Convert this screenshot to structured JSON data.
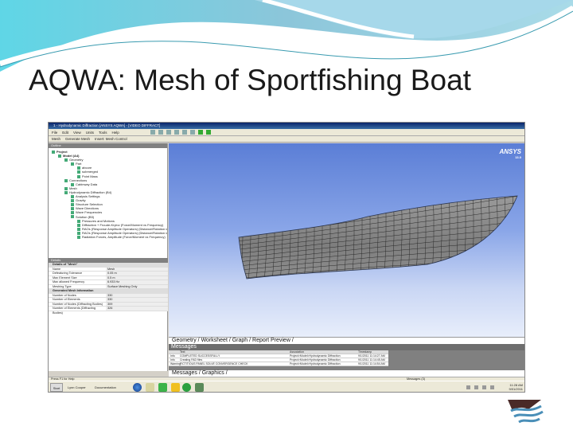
{
  "slide": {
    "title": "AQWA: Mesh of Sportfishing Boat"
  },
  "app": {
    "window_title": "1 - Hydrodynamic Diffraction [ANSYS AQWA] - [VIDEO DIFFRACT]",
    "menu": [
      "File",
      "Edit",
      "View",
      "Units",
      "Tools",
      "Help"
    ],
    "toolbar2": [
      "Mesh",
      "Generate Mesh",
      "Insert: Mesh Control"
    ],
    "outline_header": "Outline",
    "tree": [
      {
        "label": "Project",
        "level": 0
      },
      {
        "label": "Model (A4)",
        "level": 1
      },
      {
        "label": "Geometry",
        "level": 2
      },
      {
        "label": "Part",
        "level": 3
      },
      {
        "label": "abcore",
        "level": 4
      },
      {
        "label": "submerged",
        "level": 4
      },
      {
        "label": "Point Mass",
        "level": 4
      },
      {
        "label": "Connections",
        "level": 2
      },
      {
        "label": "Cabinway Data",
        "level": 3
      },
      {
        "label": "Mesh",
        "level": 2
      },
      {
        "label": "Hydrodynamic Diffraction (B4)",
        "level": 2
      },
      {
        "label": "Analysis Settings",
        "level": 3
      },
      {
        "label": "Gravity",
        "level": 3
      },
      {
        "label": "Structure Selection",
        "level": 3
      },
      {
        "label": "Wave Directions",
        "level": 3
      },
      {
        "label": "Wave Frequencies",
        "level": 3
      },
      {
        "label": "Solution (B5)",
        "level": 3
      },
      {
        "label": "Pressures and Motions",
        "level": 4
      },
      {
        "label": "Diffraction + Froude-Krylov (Force/Moment vs Frequency)",
        "level": 4
      },
      {
        "label": "RAOs (Response Amplitude Operators) (Distance/Rotation vs Freq)",
        "level": 4
      },
      {
        "label": "RAOs (Response Amplitude Operators) (Distance/Rotation vs Freq)",
        "level": 4
      },
      {
        "label": "Radiation Forces, Amplitude (Force/Moment vs Frequency)",
        "level": 4
      }
    ],
    "details_header": "Details",
    "details": [
      {
        "section": "Details of \"Mesh\""
      },
      {
        "k": "Name",
        "v": "Mesh"
      },
      {
        "k": "Defeaturing Tolerance",
        "v": "0.05 m"
      },
      {
        "k": "Max Element Size",
        "v": "0.5 m"
      },
      {
        "k": "Max allowed Frequency",
        "v": "6.933 Hz"
      },
      {
        "k": "Meshing Type",
        "v": "Surface Meshing Only"
      },
      {
        "section": "Generated Mesh Information"
      },
      {
        "k": "Number of Nodes",
        "v": "330"
      },
      {
        "k": "Number of Elements",
        "v": "330"
      },
      {
        "k": "Number of Nodes (Diffracting Bodies)",
        "v": "309"
      },
      {
        "k": "Number of Elements (Diffracting Bodies)",
        "v": "326"
      }
    ],
    "viewport_logo": {
      "brand": "ANSYS",
      "version": "13.0"
    },
    "view_tabs": "Geometry / Worksheet / Graph / Report Preview /",
    "messages_header": "Messages",
    "messages_columns": [
      "",
      "Text",
      "Association",
      "Timestamp"
    ],
    "messages": [
      [
        "Info",
        "COMPLETED SUCCESSFULLY",
        "Project>Model>Hydrodynamic Diffraction",
        "9/1/2011 11:14:27 AM"
      ],
      [
        "Info",
        "Creating FAD files",
        "Project>Model>Hydrodynamic Diffraction",
        "9/1/2011 11:14:45 AM"
      ],
      [
        "Warning",
        "FICTITIOUS PANEL SOLVE CONVERGENCE CHECK",
        "Project>Model>Hydrodynamic Diffraction",
        "9/1/2011 11:14:54 AM"
      ]
    ],
    "message_tabs": "Messages / Graphics /",
    "status_left": "Press F1 for Help",
    "status_right": "Messages (3)",
    "taskbar": {
      "start": "Start",
      "task1": "Lynn Cooper",
      "task2": "Documentation",
      "time": "11:28 AM",
      "date": "9/01/2011"
    }
  },
  "colors": {
    "accent": "#3aa7c9",
    "viewport_top": "#5b7ed6",
    "hull": "#8c8c8c"
  }
}
